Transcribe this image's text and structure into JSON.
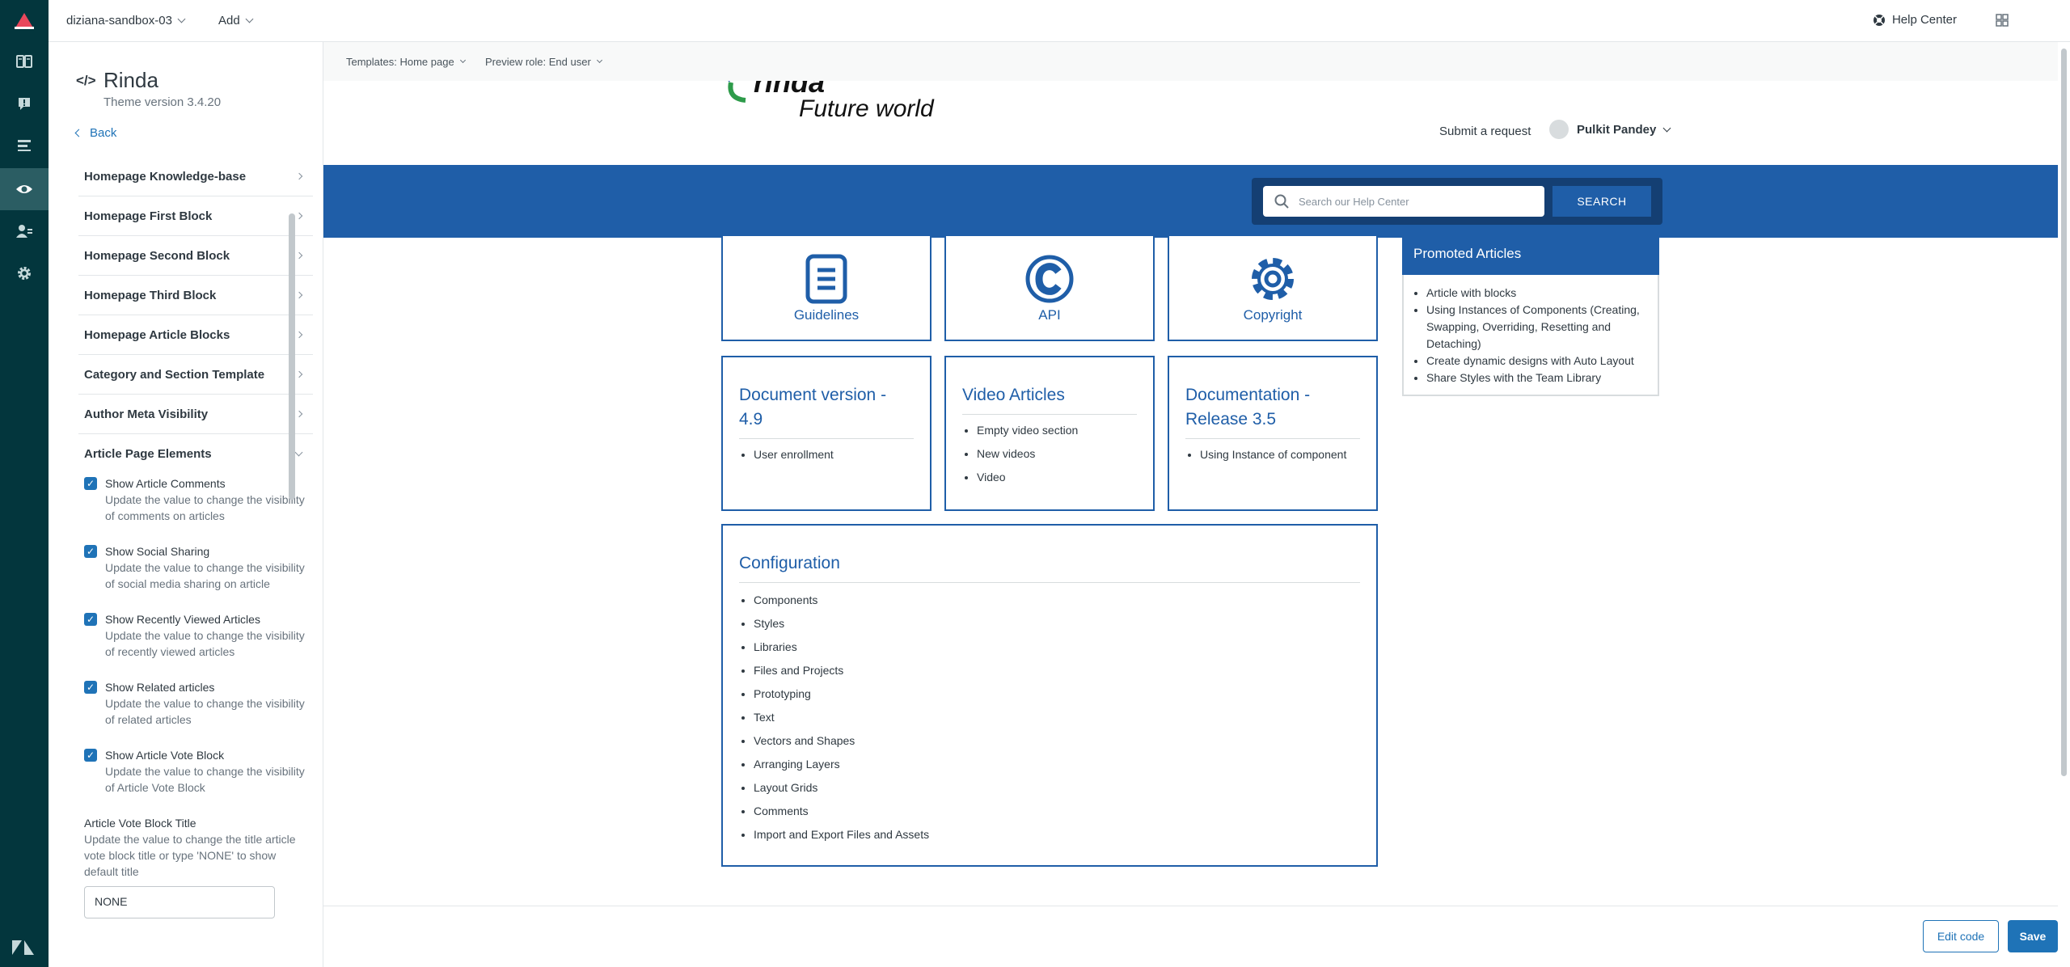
{
  "topbar": {
    "account": "diziana-sandbox-03",
    "add": "Add",
    "help_center": "Help Center"
  },
  "nav": {
    "items": [
      "guide-icon",
      "support-icon",
      "list-icon",
      "eye-icon",
      "user-icon",
      "gear-icon"
    ],
    "active": "eye-icon"
  },
  "theme": {
    "name": "Rinda",
    "version": "Theme version 3.4.20",
    "back": "Back"
  },
  "sections": [
    {
      "label": "Homepage Knowledge-base"
    },
    {
      "label": "Homepage First Block"
    },
    {
      "label": "Homepage Second Block"
    },
    {
      "label": "Homepage Third Block"
    },
    {
      "label": "Homepage Article Blocks"
    },
    {
      "label": "Category and Section Template"
    },
    {
      "label": "Author Meta Visibility"
    },
    {
      "label": "Article Page Elements"
    }
  ],
  "options": [
    {
      "label": "Show Article Comments",
      "desc": "Update the value to change the visibility of comments on articles"
    },
    {
      "label": "Show Social Sharing",
      "desc": "Update the value to change the visibility of social media sharing on article"
    },
    {
      "label": "Show Recently Viewed Articles",
      "desc": "Update the value to change the visibility of recently viewed articles"
    },
    {
      "label": "Show Related articles",
      "desc": "Update the value to change the visibility of related articles"
    },
    {
      "label": "Show Article Vote Block",
      "desc": "Update the value to change the visibility of Article Vote Block"
    }
  ],
  "vote_title": {
    "label": "Article Vote Block Title",
    "desc": "Update the value to change the title article vote block title or type 'NONE' to show default title",
    "value": "NONE"
  },
  "preview": {
    "templates": "Templates: Home page",
    "role": "Preview role: End user",
    "logo_text": "Future world",
    "logo_word": "rinda",
    "submit": "Submit a request",
    "user": "Pulkit Pandey",
    "search_placeholder": "Search our Help Center",
    "search_button": "SEARCH",
    "cards": [
      {
        "name": "Guidelines",
        "icon": "document-icon"
      },
      {
        "name": "API",
        "icon": "copyright-icon"
      },
      {
        "name": "Copyright",
        "icon": "gear-icon"
      }
    ],
    "sections": [
      {
        "title": "Document version - 4.9",
        "items": [
          "User enrollment"
        ]
      },
      {
        "title": "Video Articles",
        "items": [
          "Empty video section",
          "New videos",
          "Video"
        ]
      },
      {
        "title": "Documentation - Release 3.5",
        "items": [
          "Using Instance of component"
        ]
      }
    ],
    "configuration": {
      "title": "Configuration",
      "items": [
        "Components",
        "Styles",
        "Libraries",
        "Files and Projects",
        "Prototyping",
        "Text",
        "Vectors and Shapes",
        "Arranging Layers",
        "Layout Grids",
        "Comments",
        "Import and Export Files and Assets"
      ]
    },
    "promoted": {
      "title": "Promoted Articles",
      "items": [
        "Article with blocks",
        "Using Instances of Components (Creating, Swapping, Overriding, Resetting and Detaching)",
        "Create dynamic designs with Auto Layout",
        "Share Styles with the Team Library"
      ]
    }
  },
  "footer": {
    "edit_code": "Edit code",
    "save": "Save"
  },
  "colors": {
    "rail": "#03363d",
    "brand_blue": "#1f5ea8",
    "primary": "#1f73b7"
  }
}
